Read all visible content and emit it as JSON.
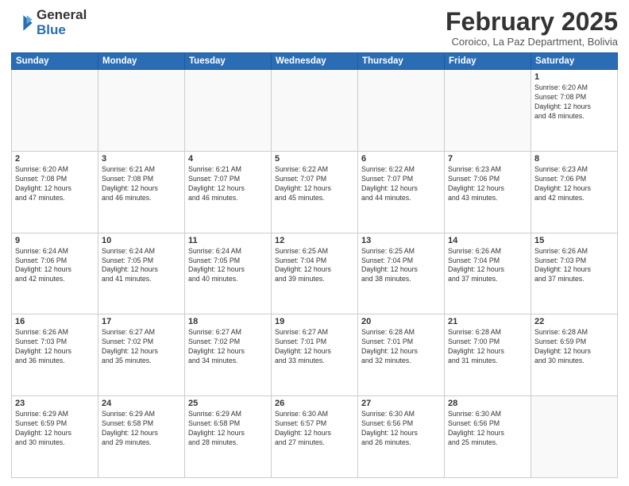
{
  "header": {
    "logo_general": "General",
    "logo_blue": "Blue",
    "month_title": "February 2025",
    "location": "Coroico, La Paz Department, Bolivia"
  },
  "calendar": {
    "days_of_week": [
      "Sunday",
      "Monday",
      "Tuesday",
      "Wednesday",
      "Thursday",
      "Friday",
      "Saturday"
    ],
    "weeks": [
      [
        {
          "day": "",
          "info": ""
        },
        {
          "day": "",
          "info": ""
        },
        {
          "day": "",
          "info": ""
        },
        {
          "day": "",
          "info": ""
        },
        {
          "day": "",
          "info": ""
        },
        {
          "day": "",
          "info": ""
        },
        {
          "day": "1",
          "info": "Sunrise: 6:20 AM\nSunset: 7:08 PM\nDaylight: 12 hours\nand 48 minutes."
        }
      ],
      [
        {
          "day": "2",
          "info": "Sunrise: 6:20 AM\nSunset: 7:08 PM\nDaylight: 12 hours\nand 47 minutes."
        },
        {
          "day": "3",
          "info": "Sunrise: 6:21 AM\nSunset: 7:08 PM\nDaylight: 12 hours\nand 46 minutes."
        },
        {
          "day": "4",
          "info": "Sunrise: 6:21 AM\nSunset: 7:07 PM\nDaylight: 12 hours\nand 46 minutes."
        },
        {
          "day": "5",
          "info": "Sunrise: 6:22 AM\nSunset: 7:07 PM\nDaylight: 12 hours\nand 45 minutes."
        },
        {
          "day": "6",
          "info": "Sunrise: 6:22 AM\nSunset: 7:07 PM\nDaylight: 12 hours\nand 44 minutes."
        },
        {
          "day": "7",
          "info": "Sunrise: 6:23 AM\nSunset: 7:06 PM\nDaylight: 12 hours\nand 43 minutes."
        },
        {
          "day": "8",
          "info": "Sunrise: 6:23 AM\nSunset: 7:06 PM\nDaylight: 12 hours\nand 42 minutes."
        }
      ],
      [
        {
          "day": "9",
          "info": "Sunrise: 6:24 AM\nSunset: 7:06 PM\nDaylight: 12 hours\nand 42 minutes."
        },
        {
          "day": "10",
          "info": "Sunrise: 6:24 AM\nSunset: 7:05 PM\nDaylight: 12 hours\nand 41 minutes."
        },
        {
          "day": "11",
          "info": "Sunrise: 6:24 AM\nSunset: 7:05 PM\nDaylight: 12 hours\nand 40 minutes."
        },
        {
          "day": "12",
          "info": "Sunrise: 6:25 AM\nSunset: 7:04 PM\nDaylight: 12 hours\nand 39 minutes."
        },
        {
          "day": "13",
          "info": "Sunrise: 6:25 AM\nSunset: 7:04 PM\nDaylight: 12 hours\nand 38 minutes."
        },
        {
          "day": "14",
          "info": "Sunrise: 6:26 AM\nSunset: 7:04 PM\nDaylight: 12 hours\nand 37 minutes."
        },
        {
          "day": "15",
          "info": "Sunrise: 6:26 AM\nSunset: 7:03 PM\nDaylight: 12 hours\nand 37 minutes."
        }
      ],
      [
        {
          "day": "16",
          "info": "Sunrise: 6:26 AM\nSunset: 7:03 PM\nDaylight: 12 hours\nand 36 minutes."
        },
        {
          "day": "17",
          "info": "Sunrise: 6:27 AM\nSunset: 7:02 PM\nDaylight: 12 hours\nand 35 minutes."
        },
        {
          "day": "18",
          "info": "Sunrise: 6:27 AM\nSunset: 7:02 PM\nDaylight: 12 hours\nand 34 minutes."
        },
        {
          "day": "19",
          "info": "Sunrise: 6:27 AM\nSunset: 7:01 PM\nDaylight: 12 hours\nand 33 minutes."
        },
        {
          "day": "20",
          "info": "Sunrise: 6:28 AM\nSunset: 7:01 PM\nDaylight: 12 hours\nand 32 minutes."
        },
        {
          "day": "21",
          "info": "Sunrise: 6:28 AM\nSunset: 7:00 PM\nDaylight: 12 hours\nand 31 minutes."
        },
        {
          "day": "22",
          "info": "Sunrise: 6:28 AM\nSunset: 6:59 PM\nDaylight: 12 hours\nand 30 minutes."
        }
      ],
      [
        {
          "day": "23",
          "info": "Sunrise: 6:29 AM\nSunset: 6:59 PM\nDaylight: 12 hours\nand 30 minutes."
        },
        {
          "day": "24",
          "info": "Sunrise: 6:29 AM\nSunset: 6:58 PM\nDaylight: 12 hours\nand 29 minutes."
        },
        {
          "day": "25",
          "info": "Sunrise: 6:29 AM\nSunset: 6:58 PM\nDaylight: 12 hours\nand 28 minutes."
        },
        {
          "day": "26",
          "info": "Sunrise: 6:30 AM\nSunset: 6:57 PM\nDaylight: 12 hours\nand 27 minutes."
        },
        {
          "day": "27",
          "info": "Sunrise: 6:30 AM\nSunset: 6:56 PM\nDaylight: 12 hours\nand 26 minutes."
        },
        {
          "day": "28",
          "info": "Sunrise: 6:30 AM\nSunset: 6:56 PM\nDaylight: 12 hours\nand 25 minutes."
        },
        {
          "day": "",
          "info": ""
        }
      ]
    ]
  }
}
